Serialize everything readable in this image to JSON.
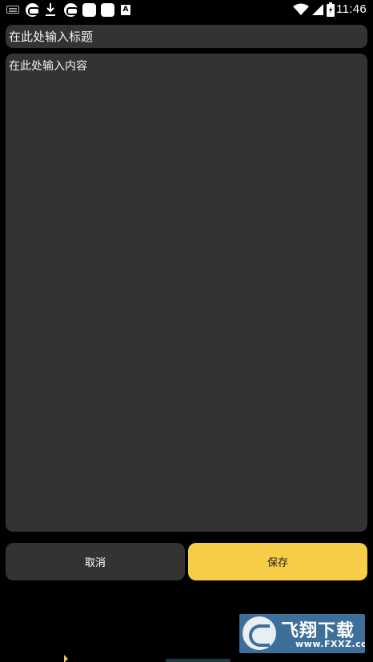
{
  "status_bar": {
    "time": "11:46",
    "left_icons": [
      "keyboard-icon",
      "app-circle-icon",
      "download-icon",
      "app-circle-icon",
      "app-square-icon",
      "app-square-icon",
      "a-icon"
    ],
    "a_label": "A",
    "right_icons": [
      "wifi-icon",
      "signal-icon",
      "battery-icon"
    ]
  },
  "editor": {
    "title_placeholder": "在此处输入标题",
    "content_placeholder": "在此处输入内容"
  },
  "actions": {
    "cancel_label": "取消",
    "save_label": "保存"
  },
  "watermark": {
    "brand": "飞翔下载",
    "url": "www.FXXZ.com"
  },
  "colors": {
    "background": "#000000",
    "field_bg": "#333333",
    "accent": "#f7cd48",
    "watermark_bg": "#3d6f9a"
  }
}
